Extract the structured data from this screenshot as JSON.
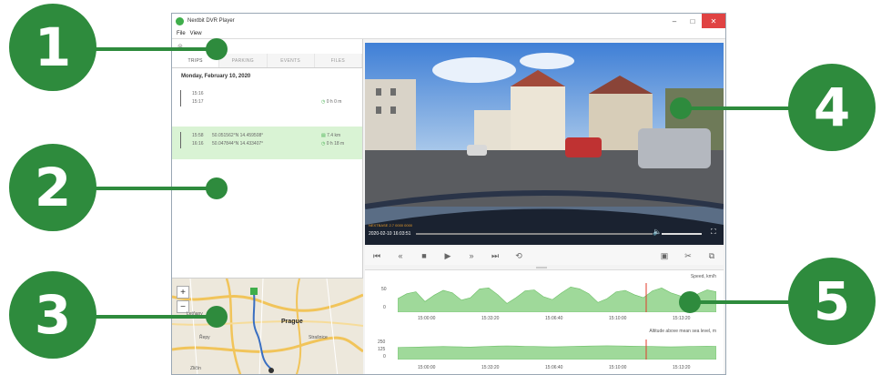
{
  "app": {
    "title": "Nextbit DVR Player",
    "menu": [
      "File",
      "View"
    ]
  },
  "left_panel": {
    "toolbar_icon": "filter-icon",
    "tabs": [
      {
        "label": "TRIPS",
        "active": true
      },
      {
        "label": "PARKING",
        "active": false
      },
      {
        "label": "EVENTS",
        "active": false
      },
      {
        "label": "FILES",
        "active": false
      }
    ],
    "date_heading": "Monday, February 10, 2020",
    "trips": [
      {
        "start": "15:16",
        "end": "15:17",
        "start_loc": "",
        "end_loc": "",
        "duration": "0 h 0 m",
        "distance": "",
        "selected": false
      },
      {
        "start": "15:58",
        "end": "16:16",
        "start_loc": "50.051562°N 14.459508°",
        "end_loc": "50.047844°N 14.433407°",
        "duration": "0 h 18 m",
        "distance": "7.4 km",
        "selected": true
      }
    ]
  },
  "map": {
    "labels": [
      "Letňany",
      "Prague",
      "Řepy",
      "Strašnice",
      "Zličín"
    ],
    "zoom_in": "+",
    "zoom_out": "−"
  },
  "video": {
    "overlay_a": "NEXTBASE 2.7  0000 0000",
    "overlay_b": "2020-02-10 16:03:51"
  },
  "controls": {
    "left": [
      {
        "name": "skip-to-start-icon",
        "glyph": "⏮"
      },
      {
        "name": "rewind-icon",
        "glyph": "«"
      },
      {
        "name": "stop-icon",
        "glyph": "■"
      },
      {
        "name": "play-icon",
        "glyph": "▶"
      },
      {
        "name": "fast-forward-icon",
        "glyph": "»"
      },
      {
        "name": "skip-to-end-icon",
        "glyph": "⏭"
      },
      {
        "name": "loop-icon",
        "glyph": "⟲"
      }
    ],
    "right": [
      {
        "name": "save-icon",
        "glyph": "💾"
      },
      {
        "name": "cut-icon",
        "glyph": "✂"
      },
      {
        "name": "copy-icon",
        "glyph": "⧉"
      }
    ]
  },
  "charts": {
    "speed_title": "Speed, km/h",
    "altitude_title": "Altitude above mean sea level, m",
    "speed_yticks": [
      "50",
      "0"
    ],
    "altitude_yticks": [
      "250",
      "125",
      "0"
    ],
    "xticks": [
      "15:00:00",
      "15:33:20",
      "15:06:40",
      "15:10:00",
      "15:13:20"
    ]
  },
  "callouts": [
    "1",
    "2",
    "3",
    "4",
    "5"
  ],
  "colors": {
    "callout_green": "#2e8b3d",
    "selected_row": "#d9f3d4",
    "chart_fill": "#9fd99a",
    "marker_red": "#e03a2a"
  },
  "chart_data": [
    {
      "type": "area",
      "title": "Speed, km/h",
      "xlabel": "",
      "ylabel": "",
      "x_ticks": [
        "15:00:00",
        "15:33:20",
        "15:06:40",
        "15:10:00",
        "15:13:20"
      ],
      "ylim": [
        0,
        60
      ],
      "series": [
        {
          "values": [
            28,
            38,
            42,
            22,
            35,
            45,
            40,
            25,
            30,
            48,
            50,
            36,
            18,
            30,
            44,
            46,
            32,
            26,
            40,
            52,
            48,
            38,
            20,
            28,
            42,
            45,
            36,
            30,
            44,
            50,
            40,
            34,
            24,
            38,
            46,
            42
          ]
        }
      ]
    },
    {
      "type": "area",
      "title": "Altitude above mean sea level, m",
      "xlabel": "",
      "ylabel": "",
      "x_ticks": [
        "15:00:00",
        "15:33:20",
        "15:06:40",
        "15:10:00",
        "15:13:20"
      ],
      "ylim": [
        0,
        250
      ],
      "series": [
        {
          "values": [
            150,
            152,
            155,
            158,
            160,
            162,
            160,
            158,
            156,
            160,
            165,
            168,
            170,
            168,
            165,
            162,
            160,
            158,
            160,
            163,
            166,
            168,
            170,
            172,
            170,
            168,
            166,
            164,
            162,
            160,
            158,
            160,
            162,
            164,
            166,
            165
          ]
        }
      ]
    }
  ]
}
